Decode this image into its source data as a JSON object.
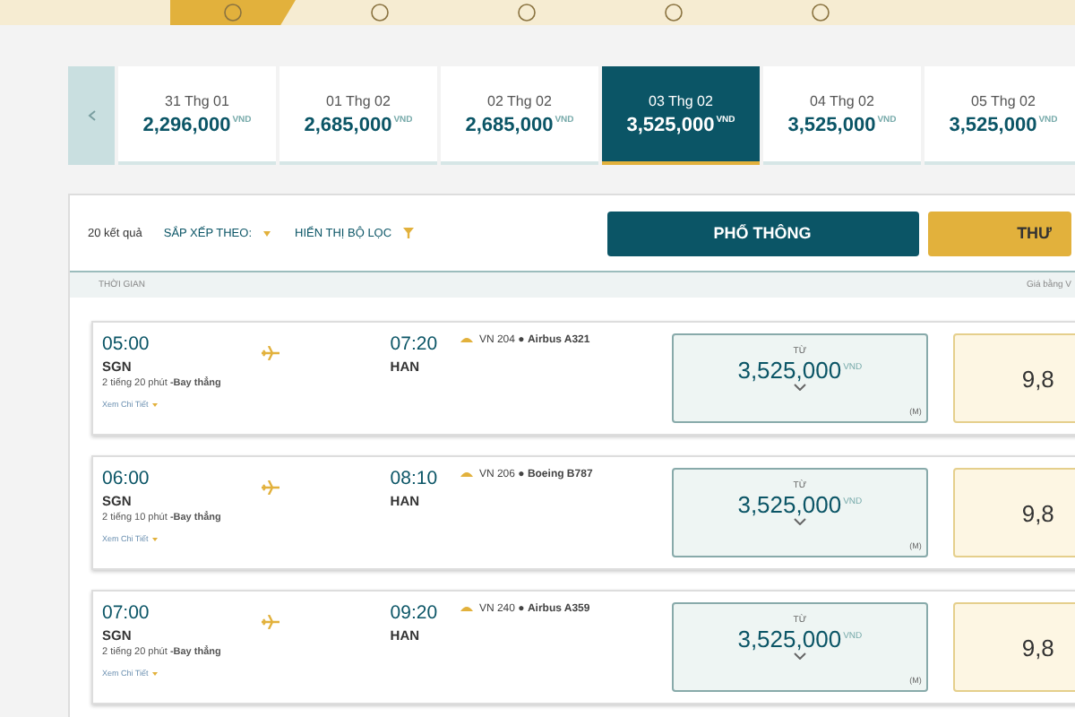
{
  "top_nav": {
    "items": [
      {
        "selected": true
      },
      {
        "selected": false
      },
      {
        "selected": false
      },
      {
        "selected": false
      },
      {
        "selected": false
      }
    ]
  },
  "date_strip": {
    "dates": [
      {
        "date": "31 Thg 01",
        "price": "2,296,000",
        "currency": "VND",
        "selected": false
      },
      {
        "date": "01 Thg 02",
        "price": "2,685,000",
        "currency": "VND",
        "selected": false
      },
      {
        "date": "02 Thg 02",
        "price": "2,685,000",
        "currency": "VND",
        "selected": false
      },
      {
        "date": "03 Thg 02",
        "price": "3,525,000",
        "currency": "VND",
        "selected": true
      },
      {
        "date": "04 Thg 02",
        "price": "3,525,000",
        "currency": "VND",
        "selected": false
      },
      {
        "date": "05 Thg 02",
        "price": "3,525,000",
        "currency": "VND",
        "selected": false
      }
    ]
  },
  "toolbar": {
    "results_count": "20 kết quả",
    "sort_label": "SẮP XẾP THEO:",
    "filter_label": "HIỂN THỊ BỘ LỌC"
  },
  "fare_tabs": [
    {
      "label": "PHỔ THÔNG",
      "kind": "economy"
    },
    {
      "label": "THƯ",
      "kind": "business"
    }
  ],
  "table": {
    "columns": [
      "THỜI GIAN",
      "Giá bằng V"
    ]
  },
  "flights": [
    {
      "dep_time": "05:00",
      "dep_airport": "SGN",
      "duration": "2 tiếng 20 phút",
      "stops": "-Bay thẳng",
      "details": "Xem Chi Tiết",
      "arr_time": "07:20",
      "arr_airport": "HAN",
      "flight_info": "VN 204 ● **Airbus A321**",
      "economy": {
        "label": "TỪ",
        "price": "3,525,000",
        "currency": "VND",
        "fare_class": "(M)"
      },
      "business": {
        "price": "9,8"
      }
    },
    {
      "dep_time": "06:00",
      "dep_airport": "SGN",
      "duration": "2 tiếng 10 phút",
      "stops": "-Bay thẳng",
      "details": "Xem Chi Tiết",
      "arr_time": "08:10",
      "arr_airport": "HAN",
      "flight_info": "VN 206 ● **Boeing B787**",
      "economy": {
        "label": "TỪ",
        "price": "3,525,000",
        "currency": "VND",
        "fare_class": "(M)"
      },
      "business": {
        "price": "9,8"
      }
    },
    {
      "dep_time": "07:00",
      "dep_airport": "SGN",
      "duration": "2 tiếng 20 phút",
      "stops": "-Bay thẳng",
      "details": "Xem Chi Tiết",
      "arr_time": "09:20",
      "arr_airport": "HAN",
      "flight_info": "VN 240 ● **Airbus A359**",
      "economy": {
        "label": "TỪ",
        "price": "3,525,000",
        "currency": "VND",
        "fare_class": "(M)"
      },
      "business": {
        "price": "9,8"
      }
    }
  ]
}
